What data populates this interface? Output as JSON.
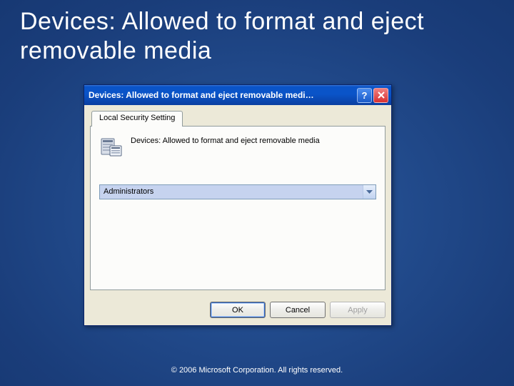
{
  "slide": {
    "title": "Devices: Allowed to format and eject removable media"
  },
  "dialog": {
    "title": "Devices: Allowed to format and eject removable medi…",
    "tab_label": "Local Security Setting",
    "policy_text": "Devices: Allowed to format and eject removable media",
    "dropdown_value": "Administrators",
    "buttons": {
      "ok": "OK",
      "cancel": "Cancel",
      "apply": "Apply"
    }
  },
  "footer": {
    "copyright": "© 2006 Microsoft Corporation. All rights reserved."
  }
}
